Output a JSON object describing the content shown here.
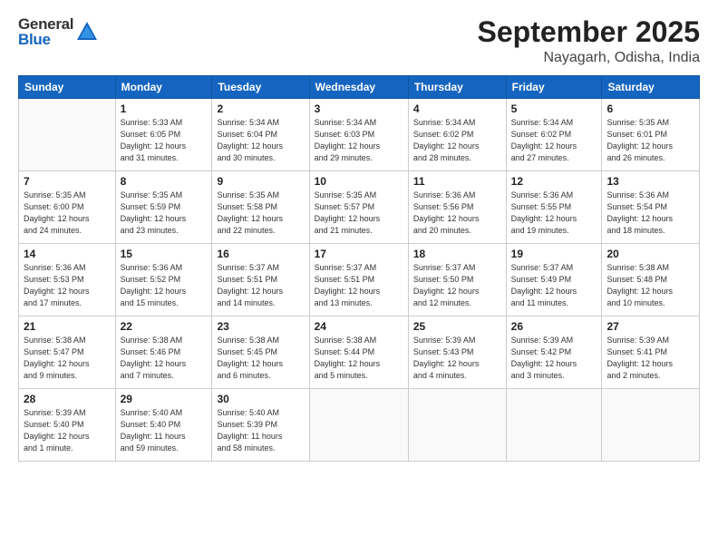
{
  "header": {
    "logo_general": "General",
    "logo_blue": "Blue",
    "month": "September 2025",
    "location": "Nayagarh, Odisha, India"
  },
  "weekdays": [
    "Sunday",
    "Monday",
    "Tuesday",
    "Wednesday",
    "Thursday",
    "Friday",
    "Saturday"
  ],
  "weeks": [
    [
      {
        "day": "",
        "info": ""
      },
      {
        "day": "1",
        "info": "Sunrise: 5:33 AM\nSunset: 6:05 PM\nDaylight: 12 hours\nand 31 minutes."
      },
      {
        "day": "2",
        "info": "Sunrise: 5:34 AM\nSunset: 6:04 PM\nDaylight: 12 hours\nand 30 minutes."
      },
      {
        "day": "3",
        "info": "Sunrise: 5:34 AM\nSunset: 6:03 PM\nDaylight: 12 hours\nand 29 minutes."
      },
      {
        "day": "4",
        "info": "Sunrise: 5:34 AM\nSunset: 6:02 PM\nDaylight: 12 hours\nand 28 minutes."
      },
      {
        "day": "5",
        "info": "Sunrise: 5:34 AM\nSunset: 6:02 PM\nDaylight: 12 hours\nand 27 minutes."
      },
      {
        "day": "6",
        "info": "Sunrise: 5:35 AM\nSunset: 6:01 PM\nDaylight: 12 hours\nand 26 minutes."
      }
    ],
    [
      {
        "day": "7",
        "info": "Sunrise: 5:35 AM\nSunset: 6:00 PM\nDaylight: 12 hours\nand 24 minutes."
      },
      {
        "day": "8",
        "info": "Sunrise: 5:35 AM\nSunset: 5:59 PM\nDaylight: 12 hours\nand 23 minutes."
      },
      {
        "day": "9",
        "info": "Sunrise: 5:35 AM\nSunset: 5:58 PM\nDaylight: 12 hours\nand 22 minutes."
      },
      {
        "day": "10",
        "info": "Sunrise: 5:35 AM\nSunset: 5:57 PM\nDaylight: 12 hours\nand 21 minutes."
      },
      {
        "day": "11",
        "info": "Sunrise: 5:36 AM\nSunset: 5:56 PM\nDaylight: 12 hours\nand 20 minutes."
      },
      {
        "day": "12",
        "info": "Sunrise: 5:36 AM\nSunset: 5:55 PM\nDaylight: 12 hours\nand 19 minutes."
      },
      {
        "day": "13",
        "info": "Sunrise: 5:36 AM\nSunset: 5:54 PM\nDaylight: 12 hours\nand 18 minutes."
      }
    ],
    [
      {
        "day": "14",
        "info": "Sunrise: 5:36 AM\nSunset: 5:53 PM\nDaylight: 12 hours\nand 17 minutes."
      },
      {
        "day": "15",
        "info": "Sunrise: 5:36 AM\nSunset: 5:52 PM\nDaylight: 12 hours\nand 15 minutes."
      },
      {
        "day": "16",
        "info": "Sunrise: 5:37 AM\nSunset: 5:51 PM\nDaylight: 12 hours\nand 14 minutes."
      },
      {
        "day": "17",
        "info": "Sunrise: 5:37 AM\nSunset: 5:51 PM\nDaylight: 12 hours\nand 13 minutes."
      },
      {
        "day": "18",
        "info": "Sunrise: 5:37 AM\nSunset: 5:50 PM\nDaylight: 12 hours\nand 12 minutes."
      },
      {
        "day": "19",
        "info": "Sunrise: 5:37 AM\nSunset: 5:49 PM\nDaylight: 12 hours\nand 11 minutes."
      },
      {
        "day": "20",
        "info": "Sunrise: 5:38 AM\nSunset: 5:48 PM\nDaylight: 12 hours\nand 10 minutes."
      }
    ],
    [
      {
        "day": "21",
        "info": "Sunrise: 5:38 AM\nSunset: 5:47 PM\nDaylight: 12 hours\nand 9 minutes."
      },
      {
        "day": "22",
        "info": "Sunrise: 5:38 AM\nSunset: 5:46 PM\nDaylight: 12 hours\nand 7 minutes."
      },
      {
        "day": "23",
        "info": "Sunrise: 5:38 AM\nSunset: 5:45 PM\nDaylight: 12 hours\nand 6 minutes."
      },
      {
        "day": "24",
        "info": "Sunrise: 5:38 AM\nSunset: 5:44 PM\nDaylight: 12 hours\nand 5 minutes."
      },
      {
        "day": "25",
        "info": "Sunrise: 5:39 AM\nSunset: 5:43 PM\nDaylight: 12 hours\nand 4 minutes."
      },
      {
        "day": "26",
        "info": "Sunrise: 5:39 AM\nSunset: 5:42 PM\nDaylight: 12 hours\nand 3 minutes."
      },
      {
        "day": "27",
        "info": "Sunrise: 5:39 AM\nSunset: 5:41 PM\nDaylight: 12 hours\nand 2 minutes."
      }
    ],
    [
      {
        "day": "28",
        "info": "Sunrise: 5:39 AM\nSunset: 5:40 PM\nDaylight: 12 hours\nand 1 minute."
      },
      {
        "day": "29",
        "info": "Sunrise: 5:40 AM\nSunset: 5:40 PM\nDaylight: 11 hours\nand 59 minutes."
      },
      {
        "day": "30",
        "info": "Sunrise: 5:40 AM\nSunset: 5:39 PM\nDaylight: 11 hours\nand 58 minutes."
      },
      {
        "day": "",
        "info": ""
      },
      {
        "day": "",
        "info": ""
      },
      {
        "day": "",
        "info": ""
      },
      {
        "day": "",
        "info": ""
      }
    ]
  ]
}
